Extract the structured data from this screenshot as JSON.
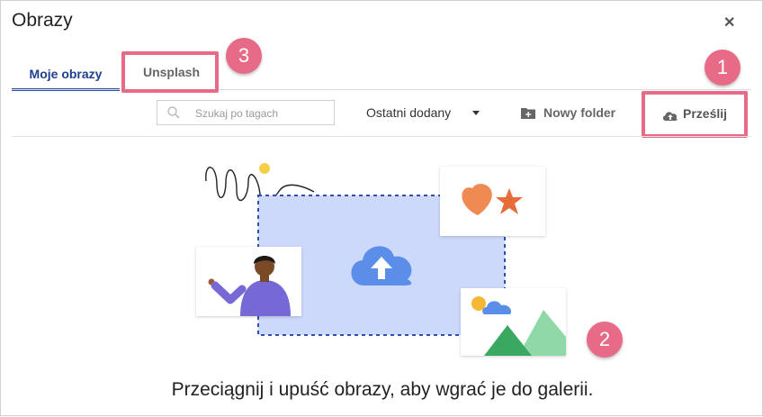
{
  "dialog": {
    "title": "Obrazy",
    "close_icon": "close-icon"
  },
  "tabs": [
    {
      "label": "Moje obrazy",
      "active": true
    },
    {
      "label": "Unsplash",
      "active": false
    }
  ],
  "toolbar": {
    "search_placeholder": "Szukaj po tagach",
    "sort_label": "Ostatni dodany",
    "new_folder_label": "Nowy folder",
    "upload_label": "Prześlij"
  },
  "callouts": [
    "1",
    "2",
    "3"
  ],
  "dropzone": {
    "text": "Przeciągnij i upuść obrazy, aby wgrać je do galerii."
  },
  "colors": {
    "accent": "#2c4fa8",
    "callout": "#e76b87",
    "dropzone_fill": "#cdd9fb",
    "dropzone_border": "#2f4fb0",
    "cloud": "#5b8ee8"
  }
}
